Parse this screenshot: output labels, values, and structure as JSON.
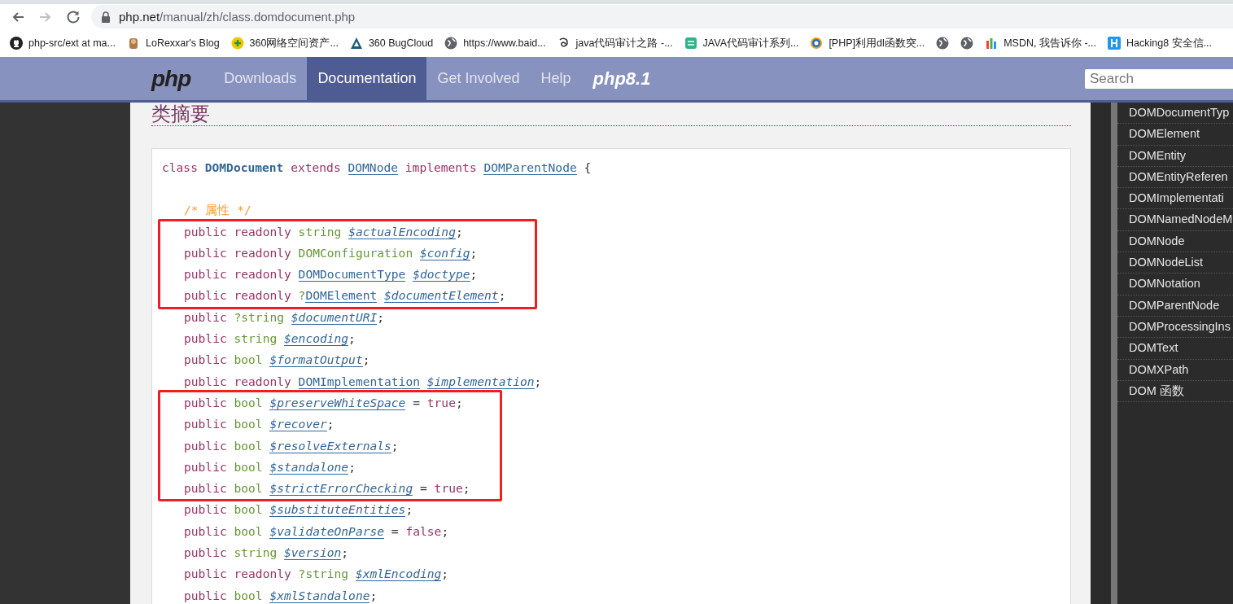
{
  "browser": {
    "url_host": "php.net",
    "url_path": "/manual/zh/class.domdocument.php",
    "back_disabled": false,
    "forward_disabled": true
  },
  "bookmarks": [
    {
      "label": "php-src/ext at ma...",
      "kind": "github"
    },
    {
      "label": "LoRexxar's Blog",
      "kind": "figure"
    },
    {
      "label": "360网络空间资产...",
      "kind": "plus"
    },
    {
      "label": "360 BugCloud",
      "kind": "triangle"
    },
    {
      "label": "https://www.baid...",
      "kind": "globe"
    },
    {
      "label": "java代码审计之路 -...",
      "kind": "swirl"
    },
    {
      "label": "JAVA代码审计系列...",
      "kind": "tile"
    },
    {
      "label": "[PHP]利用dl函数突...",
      "kind": "ring"
    },
    {
      "kind": "globe"
    },
    {
      "kind": "globe"
    },
    {
      "label": "MSDN, 我告诉你 -...",
      "kind": "msdn"
    },
    {
      "label": "Hacking8 安全信...",
      "kind": "h"
    }
  ],
  "nav": {
    "logo": "php",
    "items": [
      {
        "label": "Downloads",
        "selected": false
      },
      {
        "label": "Documentation",
        "selected": true
      },
      {
        "label": "Get Involved",
        "selected": false
      },
      {
        "label": "Help",
        "selected": false
      }
    ],
    "version_logo": "php8.1",
    "search": {
      "placeholder": "Search"
    }
  },
  "heading": "类摘要",
  "synopsis": {
    "class_line": [
      {
        "text": "class",
        "kind": "kw"
      },
      {
        "text": "DOMDocument",
        "kind": "name"
      },
      {
        "text": "extends",
        "kind": "kw"
      },
      {
        "text": "DOMNode",
        "kind": "link"
      },
      {
        "text": "implements",
        "kind": "kw"
      },
      {
        "text": "DOMParentNode",
        "kind": "link"
      },
      {
        "text": "{",
        "kind": "punct"
      }
    ],
    "groups": [
      {
        "boxed": false,
        "lines": [
          [
            {
              "text": "/* 属性 */",
              "kind": "comment"
            }
          ]
        ]
      },
      {
        "boxed": true,
        "lines": [
          [
            {
              "text": "public",
              "kind": "kw"
            },
            {
              "text": "readonly",
              "kind": "kw"
            },
            {
              "text": "string",
              "kind": "type"
            },
            {
              "text": "$actualEncoding",
              "kind": "prop"
            },
            {
              "text": ";",
              "kind": "punct",
              "joined": true
            }
          ],
          [
            {
              "text": "public",
              "kind": "kw"
            },
            {
              "text": "readonly",
              "kind": "kw"
            },
            {
              "text": "DOMConfiguration",
              "kind": "type"
            },
            {
              "text": "$config",
              "kind": "prop"
            },
            {
              "text": ";",
              "kind": "punct",
              "joined": true
            }
          ],
          [
            {
              "text": "public",
              "kind": "kw"
            },
            {
              "text": "readonly",
              "kind": "kw"
            },
            {
              "text": "DOMDocumentType",
              "kind": "link"
            },
            {
              "text": "$doctype",
              "kind": "prop"
            },
            {
              "text": ";",
              "kind": "punct",
              "joined": true
            }
          ],
          [
            {
              "text": "public",
              "kind": "kw"
            },
            {
              "text": "readonly",
              "kind": "kw"
            },
            {
              "text": "?",
              "kind": "type"
            },
            {
              "text": "DOMElement",
              "kind": "link",
              "joined": true
            },
            {
              "text": "$documentElement",
              "kind": "prop"
            },
            {
              "text": ";",
              "kind": "punct",
              "joined": true
            }
          ]
        ]
      },
      {
        "boxed": false,
        "lines": [
          [
            {
              "text": "public",
              "kind": "kw"
            },
            {
              "text": "?string",
              "kind": "type"
            },
            {
              "text": "$documentURI",
              "kind": "prop"
            },
            {
              "text": ";",
              "kind": "punct",
              "joined": true
            }
          ],
          [
            {
              "text": "public",
              "kind": "kw"
            },
            {
              "text": "string",
              "kind": "type"
            },
            {
              "text": "$encoding",
              "kind": "prop"
            },
            {
              "text": ";",
              "kind": "punct",
              "joined": true
            }
          ],
          [
            {
              "text": "public",
              "kind": "kw"
            },
            {
              "text": "bool",
              "kind": "type"
            },
            {
              "text": "$formatOutput",
              "kind": "prop"
            },
            {
              "text": ";",
              "kind": "punct",
              "joined": true
            }
          ],
          [
            {
              "text": "public",
              "kind": "kw"
            },
            {
              "text": "readonly",
              "kind": "kw"
            },
            {
              "text": "DOMImplementation",
              "kind": "link"
            },
            {
              "text": "$implementation",
              "kind": "prop"
            },
            {
              "text": ";",
              "kind": "punct",
              "joined": true
            }
          ]
        ]
      },
      {
        "boxed": true,
        "lines": [
          [
            {
              "text": "public",
              "kind": "kw"
            },
            {
              "text": "bool",
              "kind": "type"
            },
            {
              "text": "$preserveWhiteSpace",
              "kind": "prop"
            },
            {
              "text": "=",
              "kind": "punct"
            },
            {
              "text": "true",
              "kind": "value"
            },
            {
              "text": ";",
              "kind": "punct",
              "joined": true
            }
          ],
          [
            {
              "text": "public",
              "kind": "kw"
            },
            {
              "text": "bool",
              "kind": "type"
            },
            {
              "text": "$recover",
              "kind": "prop"
            },
            {
              "text": ";",
              "kind": "punct",
              "joined": true
            }
          ],
          [
            {
              "text": "public",
              "kind": "kw"
            },
            {
              "text": "bool",
              "kind": "type"
            },
            {
              "text": "$resolveExternals",
              "kind": "prop"
            },
            {
              "text": ";",
              "kind": "punct",
              "joined": true
            }
          ],
          [
            {
              "text": "public",
              "kind": "kw"
            },
            {
              "text": "bool",
              "kind": "type"
            },
            {
              "text": "$standalone",
              "kind": "prop"
            },
            {
              "text": ";",
              "kind": "punct",
              "joined": true
            }
          ],
          [
            {
              "text": "public",
              "kind": "kw"
            },
            {
              "text": "bool",
              "kind": "type"
            },
            {
              "text": "$strictErrorChecking",
              "kind": "prop"
            },
            {
              "text": "=",
              "kind": "punct"
            },
            {
              "text": "true",
              "kind": "value"
            },
            {
              "text": ";",
              "kind": "punct",
              "joined": true
            }
          ]
        ]
      },
      {
        "boxed": false,
        "lines": [
          [
            {
              "text": "public",
              "kind": "kw"
            },
            {
              "text": "bool",
              "kind": "type"
            },
            {
              "text": "$substituteEntities",
              "kind": "prop"
            },
            {
              "text": ";",
              "kind": "punct",
              "joined": true
            }
          ],
          [
            {
              "text": "public",
              "kind": "kw"
            },
            {
              "text": "bool",
              "kind": "type"
            },
            {
              "text": "$validateOnParse",
              "kind": "prop"
            },
            {
              "text": "=",
              "kind": "punct"
            },
            {
              "text": "false",
              "kind": "value"
            },
            {
              "text": ";",
              "kind": "punct",
              "joined": true
            }
          ],
          [
            {
              "text": "public",
              "kind": "kw"
            },
            {
              "text": "string",
              "kind": "type"
            },
            {
              "text": "$version",
              "kind": "prop"
            },
            {
              "text": ";",
              "kind": "punct",
              "joined": true
            }
          ],
          [
            {
              "text": "public",
              "kind": "kw"
            },
            {
              "text": "readonly",
              "kind": "kw"
            },
            {
              "text": "?string",
              "kind": "type"
            },
            {
              "text": "$xmlEncoding",
              "kind": "prop"
            },
            {
              "text": ";",
              "kind": "punct",
              "joined": true
            }
          ],
          [
            {
              "text": "public",
              "kind": "kw"
            },
            {
              "text": "bool",
              "kind": "type"
            },
            {
              "text": "$xmlStandalone",
              "kind": "prop"
            },
            {
              "text": ";",
              "kind": "punct",
              "joined": true
            }
          ]
        ]
      }
    ]
  },
  "sidebar": {
    "items": [
      "DOMDocumentTyp",
      "DOMElement",
      "DOMEntity",
      "DOMEntityReferen",
      "DOMImplementati",
      "DOMNamedNodeM",
      "DOMNode",
      "DOMNodeList",
      "DOMNotation",
      "DOMParentNode",
      "DOMProcessingIns",
      "DOMText",
      "DOMXPath",
      "DOM 函数"
    ]
  }
}
